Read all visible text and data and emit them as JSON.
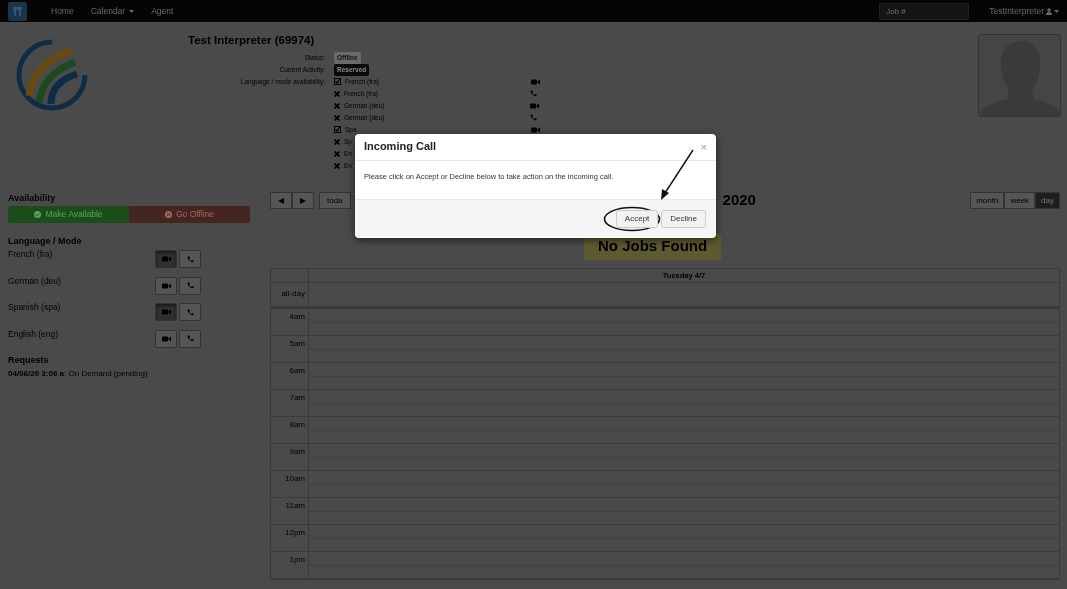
{
  "navbar": {
    "links": [
      {
        "label": "Home",
        "dropdown": false
      },
      {
        "label": "Calendar",
        "dropdown": true
      },
      {
        "label": "Agent",
        "dropdown": false
      }
    ],
    "search": {
      "placeholder": "Job #"
    },
    "user": "TestInterpreter"
  },
  "profile": {
    "name": "Test Interpreter (69974)",
    "fields": [
      {
        "label": "Status:",
        "value": "Offline",
        "kind": "light"
      },
      {
        "label": "Current Activity:",
        "value": "Reserved",
        "kind": "dark"
      }
    ],
    "availability_label": "Language / mode availability:",
    "availability": [
      {
        "language": "French (fra)",
        "checked": true,
        "kind": "video"
      },
      {
        "language": "French (fra)",
        "checked": false,
        "kind": "phone"
      },
      {
        "language": "German (deu)",
        "checked": false,
        "kind": "video"
      },
      {
        "language": "German (deu)",
        "checked": false,
        "kind": "phone"
      },
      {
        "language": "Spa",
        "checked": true,
        "kind": "video"
      },
      {
        "language": "Sp",
        "checked": false,
        "kind": "covered"
      },
      {
        "language": "En",
        "checked": false,
        "kind": "covered"
      },
      {
        "language": "En",
        "checked": false,
        "kind": "covered"
      }
    ]
  },
  "sidebar": {
    "availability_title": "Availability",
    "buttons": [
      {
        "label": "Make Available",
        "kind": "success"
      },
      {
        "label": "Go Offline",
        "kind": "danger"
      }
    ],
    "language_title": "Language / Mode",
    "languages": [
      {
        "name": "French (fra)",
        "video_on": true,
        "phone_on": false
      },
      {
        "name": "German (deu)",
        "video_on": false,
        "phone_on": false
      },
      {
        "name": "Spanish (spa)",
        "video_on": true,
        "phone_on": false
      },
      {
        "name": "English (eng)",
        "video_on": false,
        "phone_on": false
      }
    ],
    "requests_title": "Requests",
    "requests": [
      "**04/06/20 3:06 a**: On Demand (pending)"
    ]
  },
  "calendar": {
    "today": "toda",
    "title": "2020",
    "views": [
      {
        "label": "month",
        "selected": false
      },
      {
        "label": "week",
        "selected": false
      },
      {
        "label": "day",
        "selected": true
      }
    ],
    "notice": "No Jobs Found",
    "day_header": "Tuesday 4/7",
    "allday": "all-day",
    "hours": [
      "4am",
      "5am",
      "6am",
      "7am",
      "8am",
      "9am",
      "10am",
      "11am",
      "12pm",
      "1pm"
    ]
  },
  "modal": {
    "title": "Incoming Call",
    "close": "×",
    "body": "Please click on Accept or Decline below to take action on the incoming call.",
    "buttons": [
      {
        "label": "Accept",
        "circled": true
      },
      {
        "label": "Decline",
        "circled": false
      }
    ]
  }
}
